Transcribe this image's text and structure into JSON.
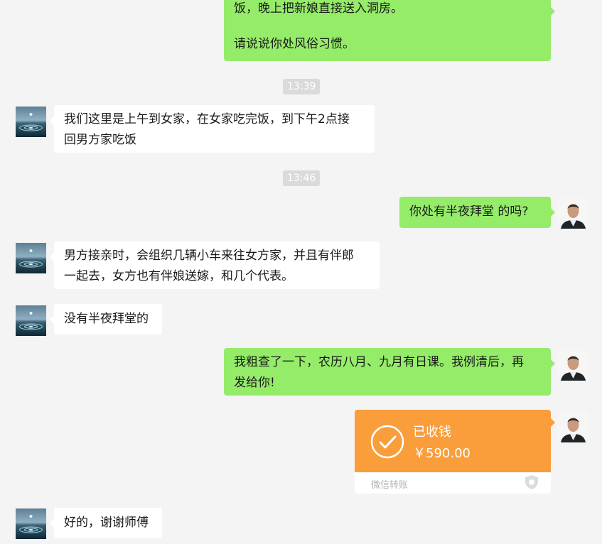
{
  "messages": {
    "m1": {
      "line1": "饭，晚上把新娘直接送入洞房。",
      "line2": "请说说你处风俗习惯。"
    },
    "t1": "13:39",
    "m2": {
      "line1": "我们这里是上午到女家，在女家吃完饭，到下午2点接",
      "line2": "回男方家吃饭"
    },
    "t2": "13:46",
    "m3": {
      "line1": "你处有半夜拜堂 的吗?"
    },
    "m4": {
      "line1": "男方接亲时，会组织几辆小车来往女方家，并且有伴郎",
      "line2": "一起去，女方也有伴娘送嫁，和几个代表。"
    },
    "m5": {
      "line1": "没有半夜拜堂的"
    },
    "m6": {
      "line1": "我粗查了一下，农历八月、九月有日课。我例清后，再",
      "line2": "发给你!"
    },
    "transfer": {
      "status": "已收钱",
      "amount": "￥590.00",
      "footer": "微信转账"
    },
    "m7": {
      "line1": "好的，谢谢师傅"
    }
  },
  "colors": {
    "background": "#f4f4f4",
    "outgoing_bubble": "#95ec69",
    "incoming_bubble": "#ffffff",
    "transfer": "#fa9d3b",
    "timestamp_bg": "#dadada"
  }
}
